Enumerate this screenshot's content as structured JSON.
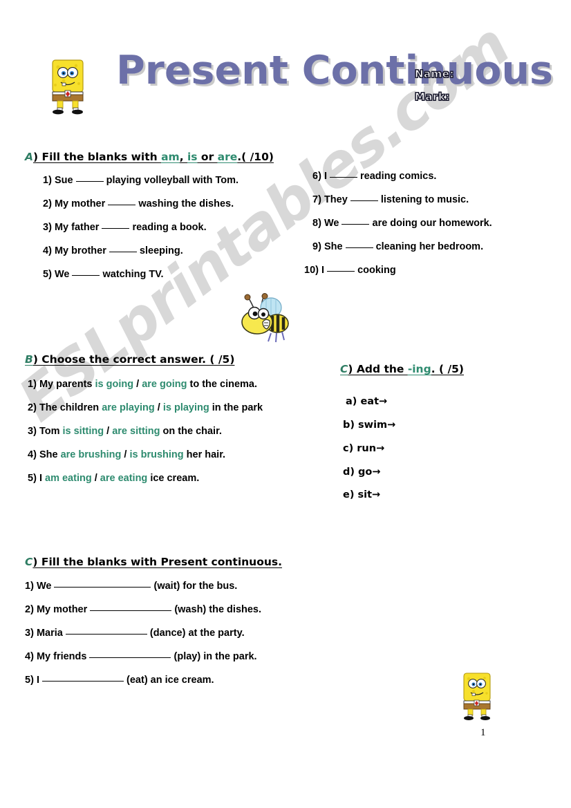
{
  "header": {
    "title": "Present Continuous",
    "name_label": "Name:",
    "mark_label": "Mark:",
    "title_color": "#6c70a8",
    "accent_green": "#2e8b6f"
  },
  "watermark": {
    "text": "ESLprintables.com",
    "color": "#d8d8d8"
  },
  "section_a": {
    "letter": "A",
    "head_pre": ") Fill the blanks with ",
    "head_green_1": "am",
    "head_mid_1": ", ",
    "head_green_2": "is",
    "head_mid_2": " or ",
    "head_green_3": "are",
    "head_post": ".(   /10)",
    "items_left": [
      {
        "num": "1)",
        "pre": "Sue",
        "post": "playing volleyball with Tom."
      },
      {
        "num": "2)",
        "pre": "My mother",
        "post": "washing the dishes."
      },
      {
        "num": "3)",
        "pre": "My father",
        "post": "reading a book."
      },
      {
        "num": "4)",
        "pre": "My brother",
        "post": "sleeping."
      },
      {
        "num": "5)",
        "pre": "We",
        "post": "watching TV."
      }
    ],
    "items_right": [
      {
        "num": "6)",
        "pre": "I",
        "post": "reading comics."
      },
      {
        "num": "7)",
        "pre": "They",
        "post": "listening to music."
      },
      {
        "num": "8)",
        "pre": "We",
        "post": "are doing our homework."
      },
      {
        "num": "9)",
        "pre": "She",
        "post": "cleaning her bedroom."
      },
      {
        "num": "10)",
        "pre": "I",
        "post": "cooking"
      }
    ]
  },
  "section_b": {
    "letter": "B",
    "head_rest": ") Choose the correct answer. (   /5)",
    "items": [
      {
        "num": "1)",
        "pre": "My parents",
        "opt1": "is going",
        "sep": "/",
        "opt2": "are going",
        "post": "to the cinema."
      },
      {
        "num": "2)",
        "pre": "The children",
        "opt1": "are playing",
        "sep": "/",
        "opt2": "is playing",
        "post": "in the park"
      },
      {
        "num": "3)",
        "pre": "Tom",
        "opt1": "is sitting",
        "sep": "/",
        "opt2": "are sitting",
        "post": "on the chair."
      },
      {
        "num": "4)",
        "pre": "She",
        "opt1": "are brushing",
        "sep": "/",
        "opt2": "is brushing",
        "post": "her hair."
      },
      {
        "num": "5)",
        "pre": "I",
        "opt1": "am eating",
        "sep": "/",
        "opt2": "are eating",
        "post": "ice cream."
      }
    ]
  },
  "section_c_ing": {
    "letter": "C",
    "head_pre": ") Add the ",
    "head_green": "-ing",
    "head_post": ". (   /5)",
    "items": [
      {
        "label": "a) eat→"
      },
      {
        "label": "b) swim→"
      },
      {
        "label": "c) run→"
      },
      {
        "label": "d) go→"
      },
      {
        "label": "e) sit→"
      }
    ]
  },
  "section_c_fill": {
    "letter": "C",
    "head_rest": ") Fill the blanks with Present continuous.",
    "items": [
      {
        "num": "1)",
        "pre": "We",
        "post": "(wait) for the bus."
      },
      {
        "num": "2)",
        "pre": "My mother",
        "post": "(wash) the dishes."
      },
      {
        "num": "3)",
        "pre": "Maria",
        "post": "(dance) at the party."
      },
      {
        "num": "4)",
        "pre": "My friends",
        "post": "(play) in the park."
      },
      {
        "num": "5)",
        "pre": "I",
        "post": "(eat) an ice cream."
      }
    ]
  },
  "footer": {
    "page_number": "1"
  }
}
